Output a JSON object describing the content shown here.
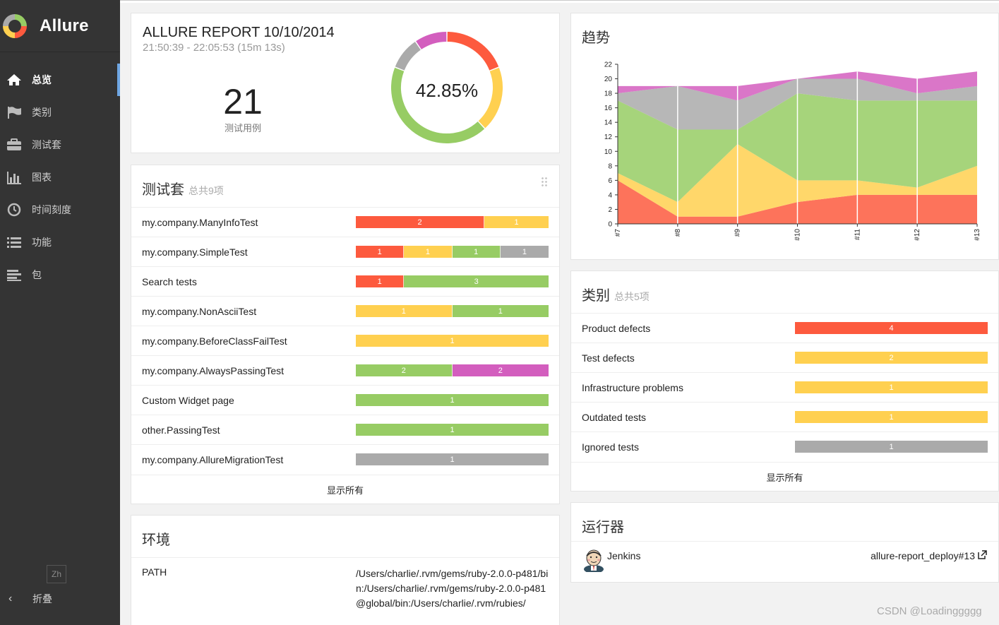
{
  "app": {
    "name": "Allure"
  },
  "sidebar": {
    "items": [
      {
        "label": "总览",
        "icon": "home-icon",
        "active": true
      },
      {
        "label": "类别",
        "icon": "flag-icon",
        "active": false
      },
      {
        "label": "测试套",
        "icon": "briefcase-icon",
        "active": false
      },
      {
        "label": "图表",
        "icon": "bar-chart-icon",
        "active": false
      },
      {
        "label": "时间刻度",
        "icon": "clock-icon",
        "active": false
      },
      {
        "label": "功能",
        "icon": "list-icon",
        "active": false
      },
      {
        "label": "包",
        "icon": "align-left-icon",
        "active": false
      }
    ],
    "language": "Zh",
    "collapse_label": "折叠"
  },
  "summary": {
    "title": "ALLURE REPORT 10/10/2014",
    "time": "21:50:39 - 22:05:53 (15m 13s)",
    "count": "21",
    "count_label": "测试用例",
    "percent": "42.85%",
    "donut": [
      {
        "status": "failed",
        "value": 4,
        "color": "#fd5a3e"
      },
      {
        "status": "broken",
        "value": 4,
        "color": "#ffd050"
      },
      {
        "status": "passed",
        "value": 9,
        "color": "#97cc64"
      },
      {
        "status": "skipped",
        "value": 2,
        "color": "#aaaaaa"
      },
      {
        "status": "unknown",
        "value": 2,
        "color": "#d35ebe"
      }
    ]
  },
  "suites": {
    "title": "测试套",
    "total_label": "总共9项",
    "rows": [
      {
        "name": "my.company.ManyInfoTest",
        "segments": [
          {
            "value": 2,
            "color": "#fd5a3e"
          },
          {
            "value": 1,
            "color": "#ffd050"
          }
        ]
      },
      {
        "name": "my.company.SimpleTest",
        "segments": [
          {
            "value": 1,
            "color": "#fd5a3e"
          },
          {
            "value": 1,
            "color": "#ffd050"
          },
          {
            "value": 1,
            "color": "#97cc64"
          },
          {
            "value": 1,
            "color": "#aaaaaa"
          }
        ]
      },
      {
        "name": "Search tests",
        "segments": [
          {
            "value": 1,
            "color": "#fd5a3e"
          },
          {
            "value": 3,
            "color": "#97cc64"
          }
        ]
      },
      {
        "name": "my.company.NonAsciiTest",
        "segments": [
          {
            "value": 1,
            "color": "#ffd050"
          },
          {
            "value": 1,
            "color": "#97cc64"
          }
        ]
      },
      {
        "name": "my.company.BeforeClassFailTest",
        "segments": [
          {
            "value": 1,
            "color": "#ffd050"
          }
        ]
      },
      {
        "name": "my.company.AlwaysPassingTest",
        "segments": [
          {
            "value": 2,
            "color": "#97cc64"
          },
          {
            "value": 2,
            "color": "#d35ebe"
          }
        ]
      },
      {
        "name": "Custom Widget page",
        "segments": [
          {
            "value": 1,
            "color": "#97cc64"
          }
        ]
      },
      {
        "name": "other.PassingTest",
        "segments": [
          {
            "value": 1,
            "color": "#97cc64"
          }
        ]
      },
      {
        "name": "my.company.AllureMigrationTest",
        "segments": [
          {
            "value": 1,
            "color": "#aaaaaa"
          }
        ]
      }
    ],
    "show_all": "显示所有"
  },
  "environment": {
    "title": "环境",
    "rows": [
      {
        "key": "PATH",
        "value": "/Users/charlie/.rvm/gems/ruby-2.0.0-p481/bin:/Users/charlie/.rvm/gems/ruby-2.0.0-p481@global/bin:/Users/charlie/.rvm/rubies/"
      }
    ]
  },
  "trend": {
    "title": "趋势"
  },
  "chart_data": {
    "type": "area",
    "x": [
      "#7",
      "#8",
      "#9",
      "#10",
      "#11",
      "#12",
      "#13"
    ],
    "ylim": [
      0,
      22
    ],
    "yticks": [
      0,
      2,
      4,
      6,
      8,
      10,
      12,
      14,
      16,
      18,
      20,
      22
    ],
    "series": [
      {
        "color": "#fd5a3e",
        "values": [
          6,
          1,
          1,
          3,
          4,
          4,
          4
        ]
      },
      {
        "color": "#ffd050",
        "values": [
          1,
          2,
          10,
          3,
          2,
          1,
          4
        ]
      },
      {
        "color": "#97cc64",
        "values": [
          10,
          10,
          2,
          12,
          11,
          12,
          9
        ]
      },
      {
        "color": "#aaaaaa",
        "values": [
          1,
          6,
          4,
          2,
          3,
          1,
          2
        ]
      },
      {
        "color": "#d35ebe",
        "values": [
          1,
          0,
          2,
          0,
          1,
          2,
          2
        ]
      }
    ]
  },
  "categories": {
    "title": "类别",
    "total_label": "总共5项",
    "rows": [
      {
        "name": "Product defects",
        "value": 4,
        "color": "#fd5a3e"
      },
      {
        "name": "Test defects",
        "value": 2,
        "color": "#ffd050"
      },
      {
        "name": "Infrastructure problems",
        "value": 1,
        "color": "#ffd050"
      },
      {
        "name": "Outdated tests",
        "value": 1,
        "color": "#ffd050"
      },
      {
        "name": "Ignored tests",
        "value": 1,
        "color": "#aaaaaa"
      }
    ],
    "show_all": "显示所有"
  },
  "executors": {
    "title": "运行器",
    "name": "Jenkins",
    "build": "allure-report_deploy#13"
  },
  "watermark": "CSDN @Loadinggggg"
}
